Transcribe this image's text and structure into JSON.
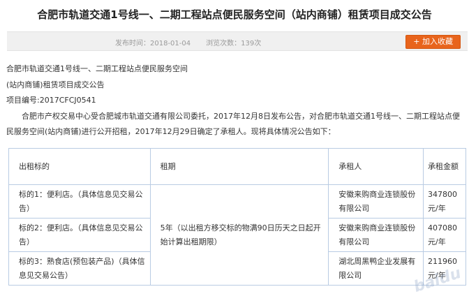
{
  "title": "合肥市轨道交通1号线一、二期工程站点便民服务空间（站内商铺）租赁项目成交公告",
  "meta": {
    "publish_label": "发布时间：",
    "publish_date": "2018-01-04",
    "views_label": "浏览次数：",
    "views_count": "139次",
    "favorite_button": "+ 加入收藏"
  },
  "body": {
    "line1": "合肥市轨道交通1号线一、二期工程站点便民服务空间",
    "line2": "(站内商铺)租赁项目成交公告",
    "line3": "项目编号:2017CFCJ0541",
    "paragraph": "合肥市产权交易中心受合肥城市轨道交通有限公司委托，2017年12月8日发布公告，对合肥市轨道交通1号线一、二期工程站点便民服务空间(站内商铺)进行公开招租，2017年12月29日确定了承租人。现将具体情况公告如下："
  },
  "table": {
    "headers": [
      "出租标的",
      "租期",
      "承租人",
      "承租金额"
    ],
    "rows": [
      {
        "item": "标的1：便利店。（具体信息见交易公告）",
        "tenant": "安徽来购商业连锁股份有限公司",
        "amount": "347800元/年"
      },
      {
        "item": "标的2：便利店。（具体信息见交易公告）",
        "tenant": "安徽来购商业连锁股份有限公司",
        "amount": "407080元/年"
      },
      {
        "item": "标的3：熟食店(预包装产品)（具体信息见交易公告）",
        "tenant": "湖北周黑鸭企业发展有限公司",
        "amount": "211960元/年"
      }
    ],
    "term": "5年（以出租方移交标的物满90日历天之日起开始计算出租期限）"
  },
  "watermark": "baidu"
}
